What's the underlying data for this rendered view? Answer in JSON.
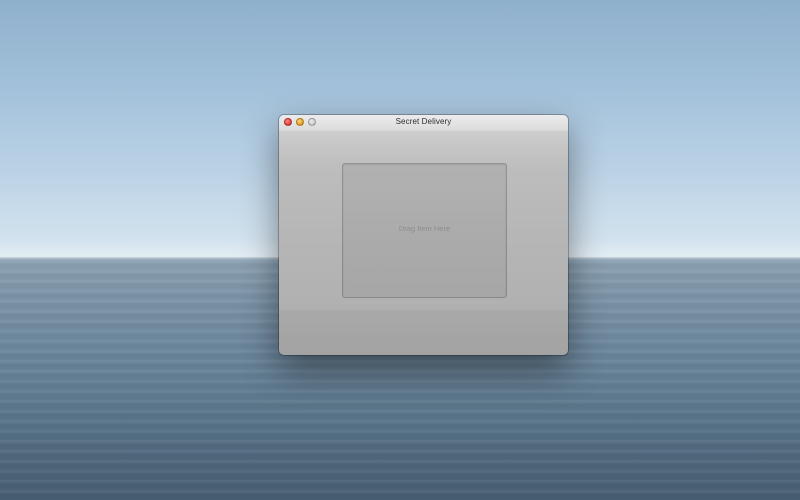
{
  "window": {
    "title": "Secret Delivery"
  },
  "drop_zone": {
    "label": "Drag Item Here"
  },
  "icons": {
    "close": "close-icon",
    "minimize": "minimize-icon",
    "zoom": "zoom-icon"
  },
  "colors": {
    "close_button": "#e0443e",
    "minimize_button": "#e4a628",
    "zoom_button": "#cfcfcf",
    "window_body": "#b6b6b6"
  }
}
